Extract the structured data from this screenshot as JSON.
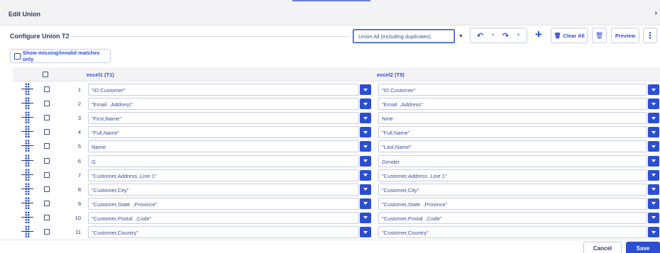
{
  "header": {
    "title": "Edit Union",
    "collapse_icon": "chevron-right-icon"
  },
  "config": {
    "title": "Configure Union T2",
    "union_mode": {
      "selected": "Union All (including duplicates)"
    },
    "toolbar": {
      "undo_icon": "undo-icon",
      "redo_icon": "redo-icon",
      "add_icon": "plus-icon",
      "clear_all_label": "Clear All",
      "delete_icon": "trash-icon",
      "preview_label": "Preview",
      "more_icon": "kebab-menu-icon"
    }
  },
  "missing_toggle": {
    "label": "Show missing/invalid matches only",
    "checked": false
  },
  "grid": {
    "col1_header": "excel1 (T1)",
    "col2_header": "excel2 (T5)",
    "rows": [
      {
        "num": "1",
        "left": "\"ID Customer\"",
        "right": "\"ID Customer\""
      },
      {
        "num": "2",
        "left": "\"Email  ,Address\"",
        "right": "\"Email  ,Address\""
      },
      {
        "num": "3",
        "left": "\"First,Name\"",
        "right": "Nme"
      },
      {
        "num": "4",
        "left": "\"Full,Name\"",
        "right": "\"Full,Name\""
      },
      {
        "num": "5",
        "left": "Name",
        "right": "\"Last,Name\""
      },
      {
        "num": "6",
        "left": "G",
        "right": "Gender"
      },
      {
        "num": "7",
        "left": "\"Customer,Address ,Line 1\"",
        "right": "\"Customer,Address ,Line 1\""
      },
      {
        "num": "8",
        "left": "\"Customer,City\"",
        "right": "\"Customer,City\""
      },
      {
        "num": "9",
        "left": "\"Customer,State  ,Province\"",
        "right": "\"Customer,State  ,Province\""
      },
      {
        "num": "10",
        "left": "\"Customer,Postal  ,Code\"",
        "right": "\"Customer,Postal  ,Code\""
      },
      {
        "num": "11",
        "left": "\"Customer,Country\"",
        "right": "\"Customer,Country\""
      }
    ]
  },
  "footer": {
    "cancel_label": "Cancel",
    "save_label": "Save"
  },
  "colors": {
    "accent": "#2d4ed1",
    "text": "#2b3a67",
    "header_bg": "#f3f3f5"
  }
}
